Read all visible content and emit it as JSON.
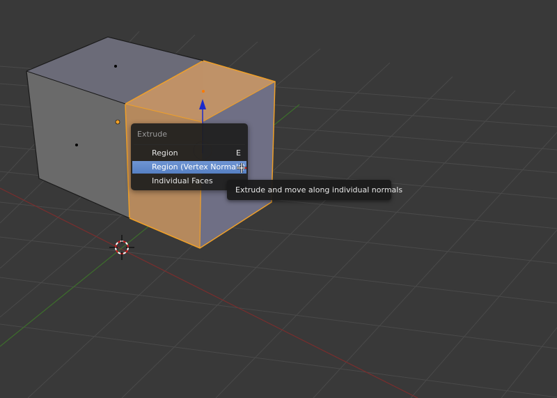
{
  "menu": {
    "title": "Extrude",
    "items": [
      {
        "label": "Region",
        "shortcut": "E",
        "active": false
      },
      {
        "label": "Region (Vertex Normals)",
        "shortcut": "",
        "active": true
      },
      {
        "label": "Individual Faces",
        "shortcut": "",
        "active": false
      }
    ]
  },
  "tooltip": {
    "text": "Extrude and move along individual normals"
  },
  "colors": {
    "background": "#393939",
    "grid": "#4a4a4a",
    "x_axis": "#7a2d2d",
    "y_axis": "#3d6e2c",
    "selection_orange": "#f0a028",
    "selected_face": "#b88a5c",
    "menu_highlight": "#5680c3",
    "normal_arrow": "#1a2acc"
  },
  "icons": [
    "3d-cursor-icon",
    "mouse-cursor-icon",
    "normal-arrow-icon"
  ]
}
